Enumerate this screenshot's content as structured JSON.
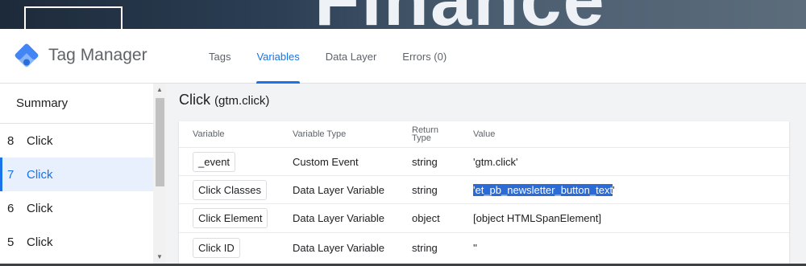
{
  "site": {
    "hero_text": "Finance"
  },
  "header": {
    "brand": "Tag Manager",
    "tabs": [
      {
        "label": "Tags",
        "active": false
      },
      {
        "label": "Variables",
        "active": true
      },
      {
        "label": "Data Layer",
        "active": false
      },
      {
        "label": "Errors (0)",
        "active": false
      }
    ]
  },
  "sidebar": {
    "summary": "Summary",
    "events": [
      {
        "num": "8",
        "label": "Click",
        "selected": false
      },
      {
        "num": "7",
        "label": "Click",
        "selected": true
      },
      {
        "num": "6",
        "label": "Click",
        "selected": false
      },
      {
        "num": "5",
        "label": "Click",
        "selected": false
      }
    ]
  },
  "main": {
    "title": "Click",
    "title_sub": "(gtm.click)",
    "table": {
      "headers": {
        "variable": "Variable",
        "type": "Variable Type",
        "return_line1": "Return",
        "return_line2": "Type",
        "value": "Value"
      },
      "rows": [
        {
          "variable": "_event",
          "type": "Custom Event",
          "return_type": "string",
          "value": "'gtm.click'"
        },
        {
          "variable": "Click Classes",
          "type": "Data Layer Variable",
          "return_type": "string",
          "value_prefix": "'",
          "value_highlight": "et_pb_newsletter_button_text",
          "value_suffix": "'"
        },
        {
          "variable": "Click Element",
          "type": "Data Layer Variable",
          "return_type": "object",
          "value": "[object HTMLSpanElement]"
        },
        {
          "variable": "Click ID",
          "type": "Data Layer Variable",
          "return_type": "string",
          "value": "''"
        }
      ]
    }
  },
  "colors": {
    "accent": "#1a73e8",
    "selection": "#2b6bd6"
  }
}
